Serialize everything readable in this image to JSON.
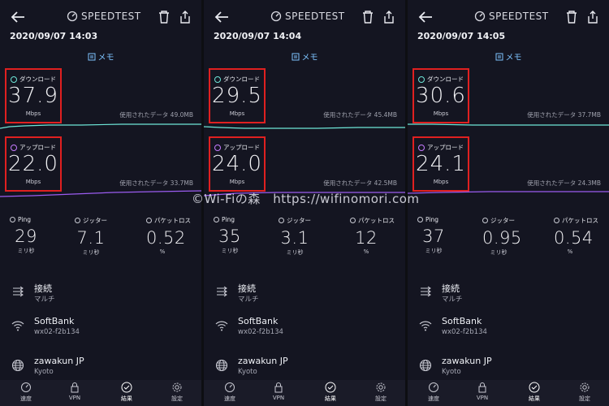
{
  "brand": {
    "name": "SPEEDTEST"
  },
  "watermark": "©Wi-Fiの森　https://wifinomori.com",
  "labels": {
    "memo": "メモ",
    "download": "ダウンロード",
    "upload": "アップロード",
    "unit_mbps": "Mbps",
    "used_data_prefix": "使用されたデータ",
    "ping": "Ping",
    "jitter": "ジッター",
    "packet_loss": "パケットロス",
    "ms": "ミリ秒",
    "percent": "%",
    "connection": "接続",
    "connection_value": "マルチ",
    "carrier": "SoftBank",
    "carrier_id": "wx02-f2b134",
    "server": "zawakun JP",
    "server_city": "Kyoto"
  },
  "nav": {
    "speed": "速度",
    "vpn": "VPN",
    "results": "結果",
    "settings": "設定"
  },
  "tests": [
    {
      "datetime": "2020/09/07 14:03",
      "download": "37.9",
      "upload": "22.0",
      "used_down": "使用されたデータ 49.0MB",
      "used_up": "使用されたデータ 33.7MB",
      "ping": "29",
      "jitter": "7.1",
      "packet_loss": "0.52"
    },
    {
      "datetime": "2020/09/07 14:04",
      "download": "29.5",
      "upload": "24.0",
      "used_down": "使用されたデータ 45.4MB",
      "used_up": "使用されたデータ 42.5MB",
      "ping": "35",
      "jitter": "3.1",
      "packet_loss": "12"
    },
    {
      "datetime": "2020/09/07 14:05",
      "download": "30.6",
      "upload": "24.1",
      "used_down": "使用されたデータ 37.7MB",
      "used_up": "使用されたデータ 24.3MB",
      "ping": "37",
      "jitter": "0.95",
      "packet_loss": "0.54"
    }
  ],
  "colors": {
    "download_line": "#6ee7d8",
    "upload_line": "#9b5cf0",
    "highlight": "#e02020"
  }
}
